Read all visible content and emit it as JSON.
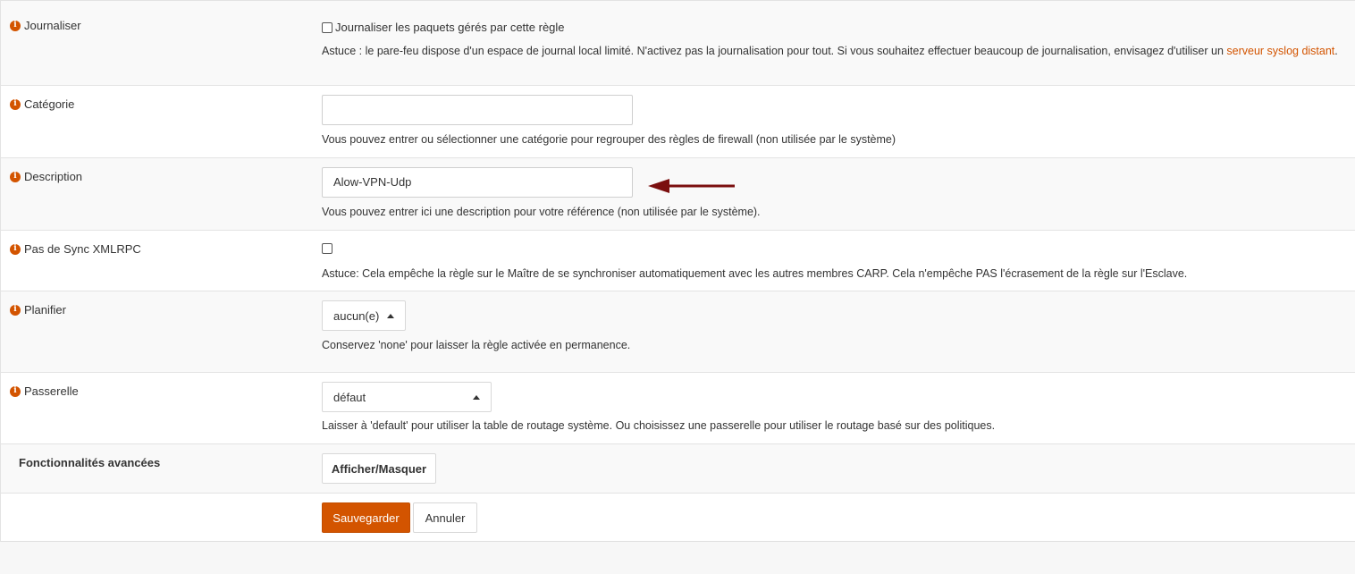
{
  "rows": {
    "log": {
      "label": "Journaliser",
      "checkbox_label": "Journaliser les paquets gérés par cette règle",
      "hint_before": "Astuce : le pare-feu dispose d'un espace de journal local limité. N'activez pas la journalisation pour tout. Si vous souhaitez effectuer beaucoup de journalisation, envisagez d'utiliser un ",
      "hint_link": "serveur syslog distant",
      "hint_after": "."
    },
    "category": {
      "label": "Catégorie",
      "value": "",
      "hint": "Vous pouvez entrer ou sélectionner une catégorie pour regrouper des règles de firewall (non utilisée par le système)"
    },
    "description": {
      "label": "Description",
      "value": "Alow-VPN-Udp",
      "hint": "Vous pouvez entrer ici une description pour votre référence (non utilisée par le système)."
    },
    "nosync": {
      "label": "Pas de Sync XMLRPC",
      "hint": "Astuce: Cela empêche la règle sur le Maître de se synchroniser automatiquement avec les autres membres CARP. Cela n'empêche PAS l'écrasement de la règle sur l'Esclave."
    },
    "schedule": {
      "label": "Planifier",
      "selected": "aucun(e)",
      "hint": "Conservez 'none' pour laisser la règle activée en permanence."
    },
    "gateway": {
      "label": "Passerelle",
      "selected": "défaut",
      "hint": "Laisser à 'default' pour utiliser la table de routage système. Ou choisissez une passerelle pour utiliser le routage basé sur des politiques."
    },
    "advanced": {
      "label": "Fonctionnalités avancées",
      "button": "Afficher/Masquer"
    }
  },
  "actions": {
    "save": "Sauvegarder",
    "cancel": "Annuler"
  },
  "colors": {
    "accent": "#d35400",
    "arrow": "#7b0f0f"
  }
}
